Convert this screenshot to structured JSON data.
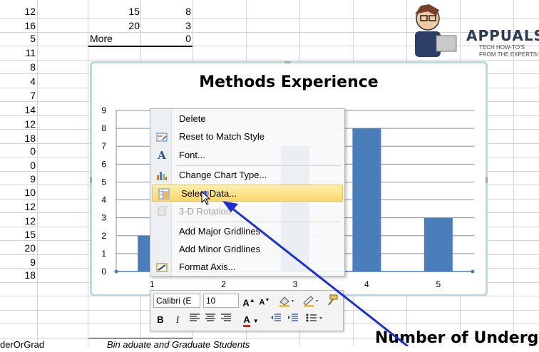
{
  "sheet": {
    "colA": [
      "12",
      "16",
      "5",
      "11",
      "8",
      "4",
      "7",
      "14",
      "12",
      "18",
      "0",
      "0",
      "9",
      "10",
      "12",
      "12",
      "15",
      "20",
      "9",
      "18"
    ],
    "colB_rows": [
      {
        "b": "15",
        "c": "8"
      },
      {
        "b": "20",
        "c": "3"
      },
      {
        "b": "More",
        "c": "0"
      }
    ],
    "footer_left": "derOrGrad",
    "footer_mid": "Bin     aduate and Graduate Students"
  },
  "chart_data": {
    "type": "bar",
    "title": "Methods Experience",
    "categories": [
      "1",
      "2",
      "3",
      "4",
      "5"
    ],
    "values": [
      2,
      0,
      7,
      8,
      3
    ],
    "ylim": [
      0,
      9
    ],
    "yticks": [
      "0",
      "1",
      "2",
      "3",
      "4",
      "5",
      "6",
      "7",
      "8",
      "9"
    ],
    "bar_color": "#4a7ebb",
    "grid": true
  },
  "context_menu": {
    "items": [
      {
        "label": "Delete",
        "icon": "none",
        "disabled": false
      },
      {
        "label": "Reset to Match Style",
        "icon": "reset-style-icon",
        "disabled": false
      },
      {
        "label": "Font...",
        "icon": "font-icon",
        "disabled": false
      },
      {
        "label": "Change Chart Type...",
        "icon": "chart-type-icon",
        "disabled": false
      },
      {
        "label": "Select Data...",
        "icon": "select-data-icon",
        "disabled": false,
        "highlighted": true
      },
      {
        "label": "3-D Rotation...",
        "icon": "rotation-icon",
        "disabled": true
      },
      {
        "label": "Add Major Gridlines",
        "icon": "none",
        "disabled": false
      },
      {
        "label": "Add Minor Gridlines",
        "icon": "none",
        "disabled": false
      },
      {
        "label": "Format Axis...",
        "icon": "format-axis-icon",
        "disabled": false
      }
    ]
  },
  "mini_toolbar": {
    "font_name": "Calibri (E",
    "font_size": "10",
    "bold": "B",
    "italic": "I",
    "grow_font": "A",
    "shrink_font": "A",
    "font_color": "A"
  },
  "logo": {
    "name": "APPUALS",
    "tagline": "TECH HOW-TO'S FROM THE EXPERTS!"
  },
  "second_chart_title": "Number of Undergra",
  "colors": {
    "arrow": "#1a2fd6",
    "chart_border": "#bcd7dd",
    "highlight": "#fbd769"
  }
}
